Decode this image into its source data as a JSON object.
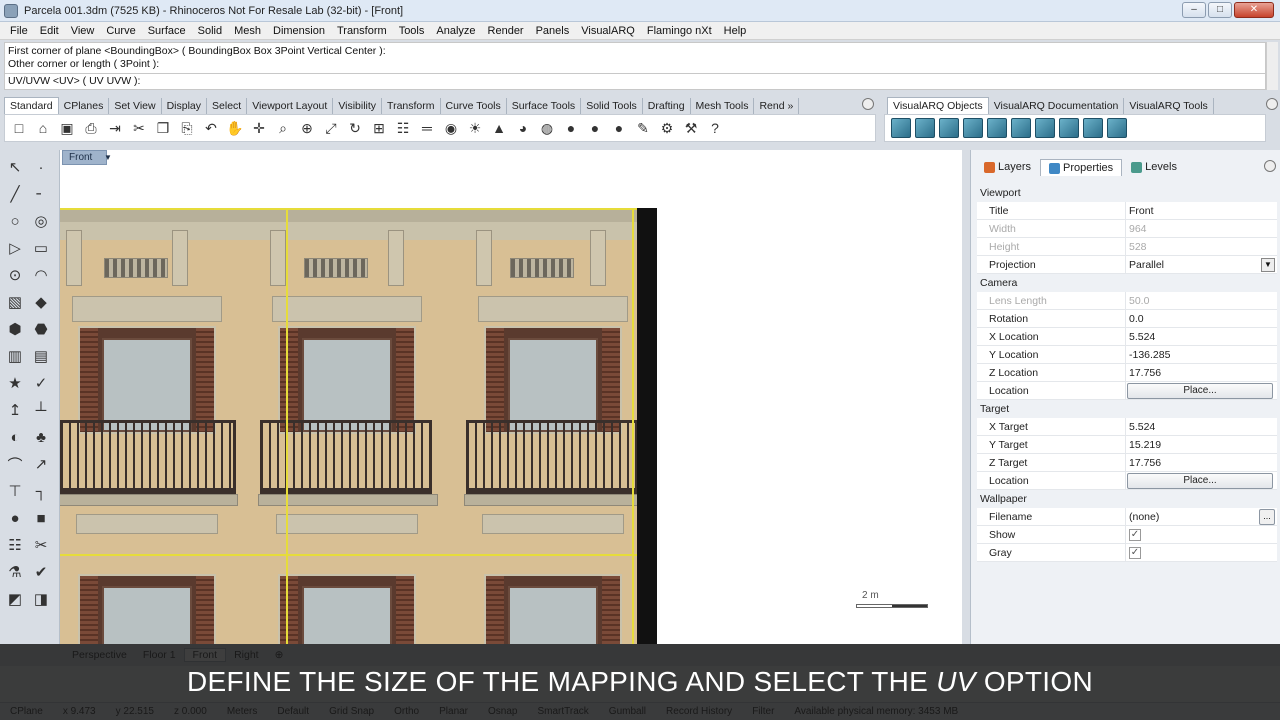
{
  "window": {
    "title": "Parcela 001.3dm (7525 KB) - Rhinoceros Not For Resale Lab (32-bit) - [Front]",
    "minimize": "–",
    "maximize": "□",
    "close": "✕"
  },
  "menu": [
    "File",
    "Edit",
    "View",
    "Curve",
    "Surface",
    "Solid",
    "Mesh",
    "Dimension",
    "Transform",
    "Tools",
    "Analyze",
    "Render",
    "Panels",
    "VisualARQ",
    "Flamingo nXt",
    "Help"
  ],
  "command": {
    "history": [
      "First corner of plane <BoundingBox> ( BoundingBox  Box  3Point  Vertical  Center ):",
      "Other corner or length ( 3Point ):"
    ],
    "prompt": "UV/UVW <UV> ( UV  UVW ):"
  },
  "toolbar_tabs": [
    "Standard",
    "CPlanes",
    "Set View",
    "Display",
    "Select",
    "Viewport Layout",
    "Visibility",
    "Transform",
    "Curve Tools",
    "Surface Tools",
    "Solid Tools",
    "Drafting",
    "Mesh Tools",
    "Rend »"
  ],
  "toolbar_tabs_right": [
    "VisualARQ Objects",
    "VisualARQ Documentation",
    "VisualARQ Tools"
  ],
  "toolbar_icons": [
    "new-file",
    "open-folder",
    "save",
    "print",
    "import",
    "cut",
    "copy",
    "paste",
    "undo",
    "pan-hand",
    "move",
    "zoom",
    "zoom-window",
    "zoom-extents",
    "rotate-view",
    "four-viewports",
    "grid",
    "cplane",
    "layers",
    "light",
    "material",
    "render",
    "color-wheel",
    "sphere-shaded",
    "sphere-render",
    "sphere-blue",
    "pencil-paint",
    "options-gear",
    "tools",
    "help"
  ],
  "toolbar_icon_glyphs": [
    "□",
    "⌂",
    "▣",
    "⎙",
    "⇥",
    "✂",
    "❐",
    "⎘",
    "↶",
    "✋",
    "✛",
    "⌕",
    "⊕",
    "⤢",
    "↻",
    "⊞",
    "☷",
    "═",
    "◉",
    "☀",
    "▲",
    "◕",
    "◍",
    "●",
    "●",
    "●",
    "✎",
    "⚙",
    "⚒",
    "?"
  ],
  "left_tool_glyphs": [
    "↖",
    "·",
    "╱",
    "╴",
    "○",
    "◎",
    "▷",
    "▭",
    "⊙",
    "◠",
    "▧",
    "◆",
    "⬢",
    "⬣",
    "▥",
    "▤",
    "★",
    "✓",
    "↥",
    "┴",
    "◐",
    "♣",
    "⌒",
    "↗",
    "⊤",
    "┐",
    "●",
    "■",
    "☷",
    "✂",
    "⚗",
    "✔",
    "◩",
    "◨"
  ],
  "viewport": {
    "label": "Front",
    "scale_text": "2 m",
    "tabs": [
      "Perspective",
      "Floor 1",
      "Front",
      "Right",
      "⊕"
    ]
  },
  "panel": {
    "tabs": [
      "Layers",
      "Properties",
      "Levels"
    ],
    "sections": [
      {
        "title": "Viewport",
        "rows": [
          {
            "label": "Title",
            "value": "Front"
          },
          {
            "label": "Width",
            "value": "964",
            "disabled": true
          },
          {
            "label": "Height",
            "value": "528",
            "disabled": true
          },
          {
            "label": "Projection",
            "value": "Parallel",
            "dropdown": true
          }
        ]
      },
      {
        "title": "Camera",
        "rows": [
          {
            "label": "Lens Length",
            "value": "50.0",
            "disabled": true
          },
          {
            "label": "Rotation",
            "value": "0.0"
          },
          {
            "label": "X Location",
            "value": "5.524"
          },
          {
            "label": "Y Location",
            "value": "-136.285"
          },
          {
            "label": "Z Location",
            "value": "17.756"
          },
          {
            "label": "Location",
            "button": "Place..."
          }
        ]
      },
      {
        "title": "Target",
        "rows": [
          {
            "label": "X Target",
            "value": "5.524"
          },
          {
            "label": "Y Target",
            "value": "15.219"
          },
          {
            "label": "Z Target",
            "value": "17.756"
          },
          {
            "label": "Location",
            "button": "Place..."
          }
        ]
      },
      {
        "title": "Wallpaper",
        "rows": [
          {
            "label": "Filename",
            "value": "(none)",
            "small_button": "..."
          },
          {
            "label": "Show",
            "checkbox": true
          },
          {
            "label": "Gray",
            "checkbox": true
          }
        ]
      }
    ]
  },
  "statusbar": {
    "items": [
      "CPlane",
      "x 9.473",
      "y 22.515",
      "z 0.000",
      "Meters",
      "Default",
      "Grid Snap",
      "Ortho",
      "Planar",
      "Osnap",
      "SmartTrack",
      "Gumball",
      "Record History",
      "Filter",
      "Available physical memory: 3453 MB"
    ]
  },
  "caption": {
    "before": "DEFINE THE SIZE OF THE MAPPING AND SELECT THE ",
    "emph": "UV",
    "after": " OPTION"
  },
  "colors": {
    "caption_bg": "#141414",
    "accent_selection": "#e6dc3a",
    "titlebar": "#dfe9f5"
  }
}
